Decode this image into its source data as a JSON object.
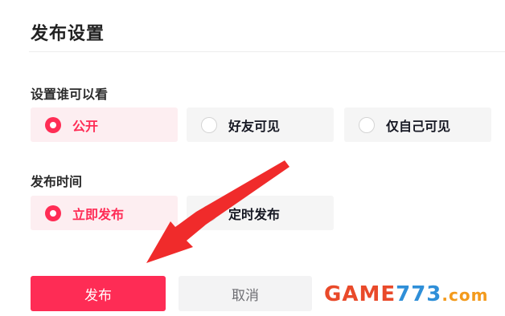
{
  "page": {
    "title": "发布设置"
  },
  "visibility": {
    "label": "设置谁可以看",
    "options": [
      {
        "label": "公开",
        "selected": true
      },
      {
        "label": "好友可见",
        "selected": false
      },
      {
        "label": "仅自己可见",
        "selected": false
      }
    ]
  },
  "publish_time": {
    "label": "发布时间",
    "options": [
      {
        "label": "立即发布",
        "selected": true
      },
      {
        "label": "定时发布",
        "selected": false
      }
    ]
  },
  "actions": {
    "publish_label": "发布",
    "cancel_label": "取消"
  },
  "watermark": {
    "part1": "GAME",
    "part2": "773",
    "part3": ".com"
  },
  "colors": {
    "accent": "#fe2c55",
    "selected_bg": "#fdeef1",
    "unselected_bg": "#f5f5f5"
  }
}
